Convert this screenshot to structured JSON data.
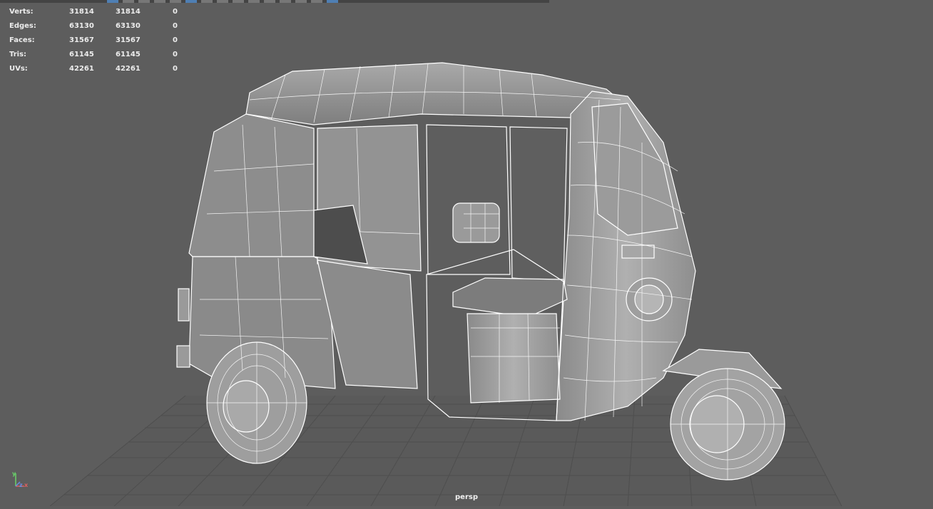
{
  "stats": {
    "rows": [
      {
        "label": "Verts:",
        "a": "31814",
        "b": "31814",
        "c": "0"
      },
      {
        "label": "Edges:",
        "a": "63130",
        "b": "63130",
        "c": "0"
      },
      {
        "label": "Faces:",
        "a": "31567",
        "b": "31567",
        "c": "0"
      },
      {
        "label": "Tris:",
        "a": "61145",
        "b": "61145",
        "c": "0"
      },
      {
        "label": "UVs:",
        "a": "42261",
        "b": "42261",
        "c": "0"
      }
    ]
  },
  "viewport": {
    "camera_name": "persp",
    "axis_labels": {
      "x": "x",
      "y": "y",
      "z": "z"
    },
    "colors": {
      "background": "#5d5d5d",
      "wire": "#ffffff",
      "shade": "#9a9a9a",
      "grid": "#6b6b6b"
    }
  }
}
